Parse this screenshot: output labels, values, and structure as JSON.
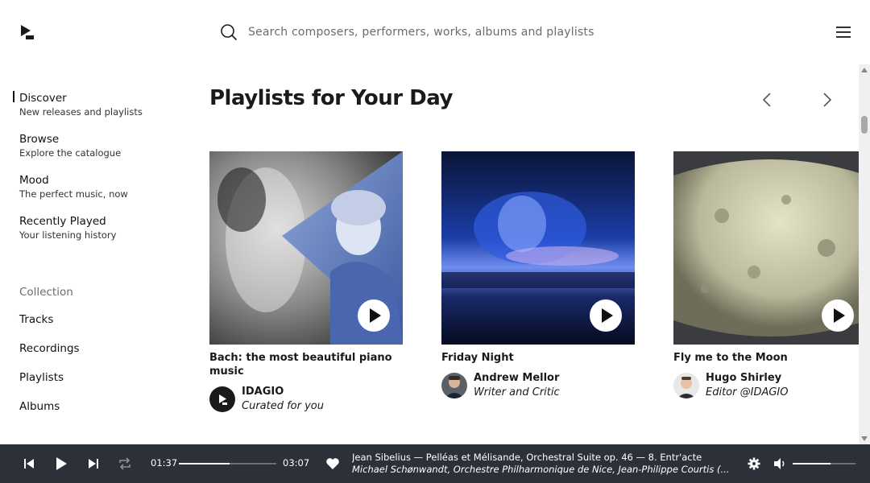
{
  "search": {
    "placeholder": "Search composers, performers, works, albums and playlists"
  },
  "sidebar": {
    "nav": [
      {
        "title": "Discover",
        "subtitle": "New releases and playlists",
        "active": true
      },
      {
        "title": "Browse",
        "subtitle": "Explore the catalogue"
      },
      {
        "title": "Mood",
        "subtitle": "The perfect music, now"
      },
      {
        "title": "Recently Played",
        "subtitle": "Your listening history"
      }
    ],
    "collection_heading": "Collection",
    "collection": [
      "Tracks",
      "Recordings",
      "Playlists",
      "Albums"
    ]
  },
  "main": {
    "section_title": "Playlists for Your Day",
    "cards": [
      {
        "title": "Bach: the most beautiful piano music",
        "curator_name": "IDAGIO",
        "curator_role": "Curated for you"
      },
      {
        "title": "Friday Night",
        "curator_name": "Andrew Mellor",
        "curator_role": "Writer and Critic"
      },
      {
        "title": "Fly me to the Moon",
        "curator_name": "Hugo Shirley",
        "curator_role": "Editor @IDAGIO"
      }
    ]
  },
  "player": {
    "elapsed": "01:37",
    "duration": "03:07",
    "progress_fraction": 0.52,
    "track_title": "Jean Sibelius — Pelléas et Mélisande, Orchestral Suite op. 46 — 8. Entr'acte",
    "track_artists": "Michael Schønwandt, Orchestre Philharmonique de Nice, Jean-Philippe Courtis (...",
    "volume_fraction": 0.6
  },
  "colors": {
    "player_bg": "#2b3039",
    "accent": "#1a1a1a"
  }
}
